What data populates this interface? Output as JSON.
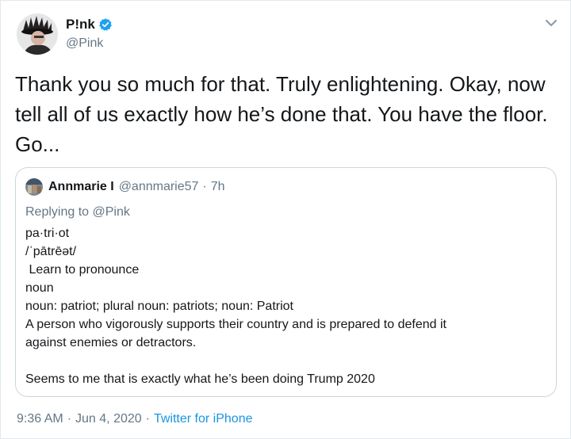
{
  "author": {
    "display_name": "P!nk",
    "handle": "@Pink",
    "verified": true
  },
  "tweet": {
    "text": "Thank you so much for that. Truly enlightening. Okay, now tell all of us exactly how he’s done that. You have the floor. Go..."
  },
  "quoted": {
    "display_name": "Annmarie I",
    "handle": "@annmarie57",
    "separator": "·",
    "time": "7h",
    "replying_prefix": "Replying to",
    "replying_to": "@Pink",
    "lines": [
      "pa·tri·ot",
      "/ˈpātrēət/",
      " Learn to pronounce",
      "noun",
      "noun: patriot; plural noun: patriots; noun: Patriot",
      "A person who vigorously supports their country and is prepared to defend it",
      "against enemies or detractors.",
      "",
      "Seems to me that is exactly what he’s been doing Trump 2020"
    ]
  },
  "footer": {
    "time": "9:36 AM",
    "sep1": "·",
    "date": "Jun 4, 2020",
    "sep2": "·",
    "source": "Twitter for iPhone"
  },
  "colors": {
    "accent": "#1da1f2",
    "link": "#1b95e0",
    "secondary_text": "#657786",
    "border": "#ccd6dd"
  },
  "icons": {
    "verified": "verified-badge-icon",
    "caret": "chevron-down-icon"
  }
}
